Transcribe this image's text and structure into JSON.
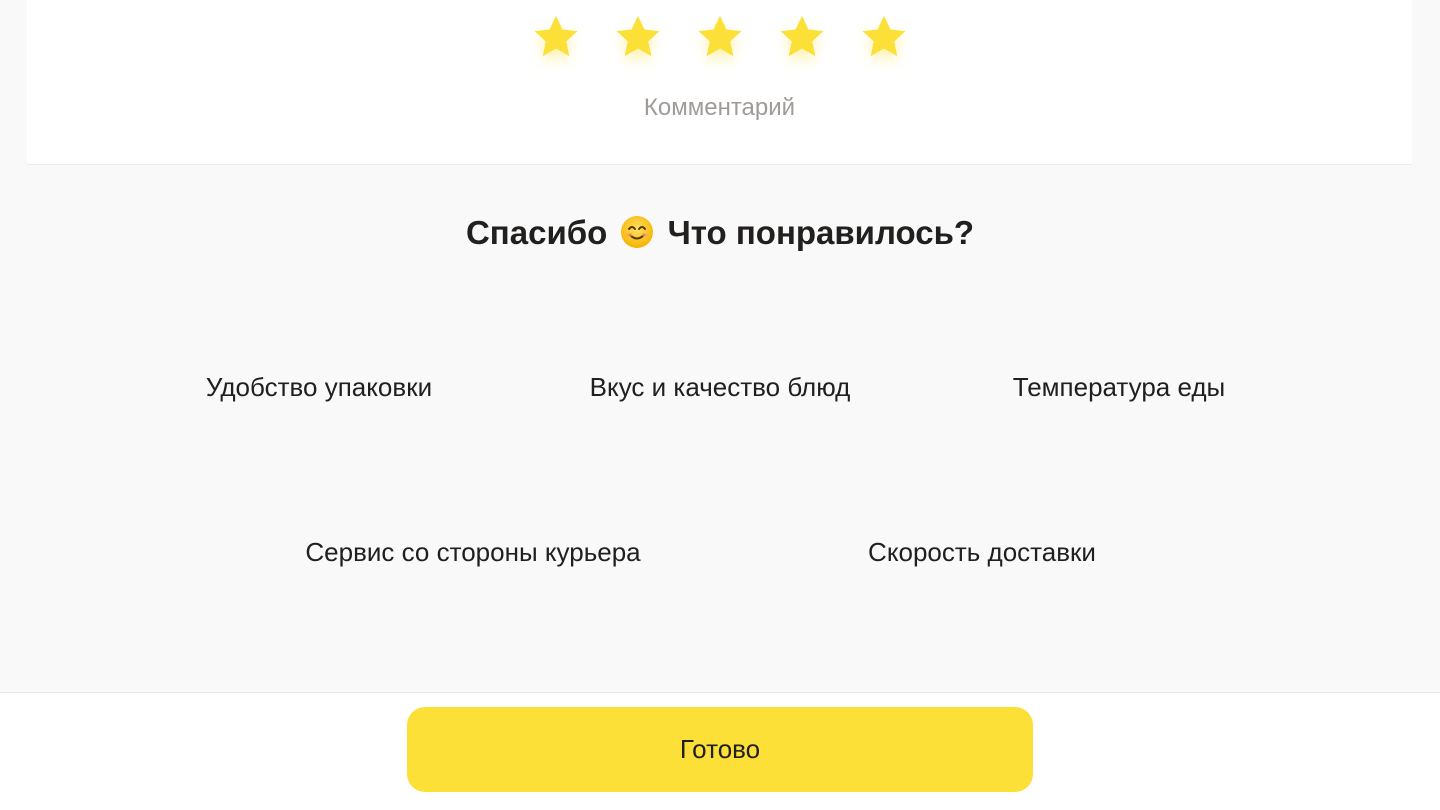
{
  "rating": {
    "value": 5,
    "max": 5,
    "star_color": "#fce038",
    "comment_placeholder": "Комментарий"
  },
  "feedback": {
    "title_before": "Спасибо",
    "title_emoji": "smiling-face-icon",
    "title_after": "Что понравилось?",
    "options": [
      "Удобство упаковки",
      "Вкус и качество блюд",
      "Температура еды",
      "Сервис со стороны курьера",
      "Скорость доставки"
    ]
  },
  "footer": {
    "done_label": "Готово",
    "button_color": "#fce038"
  }
}
